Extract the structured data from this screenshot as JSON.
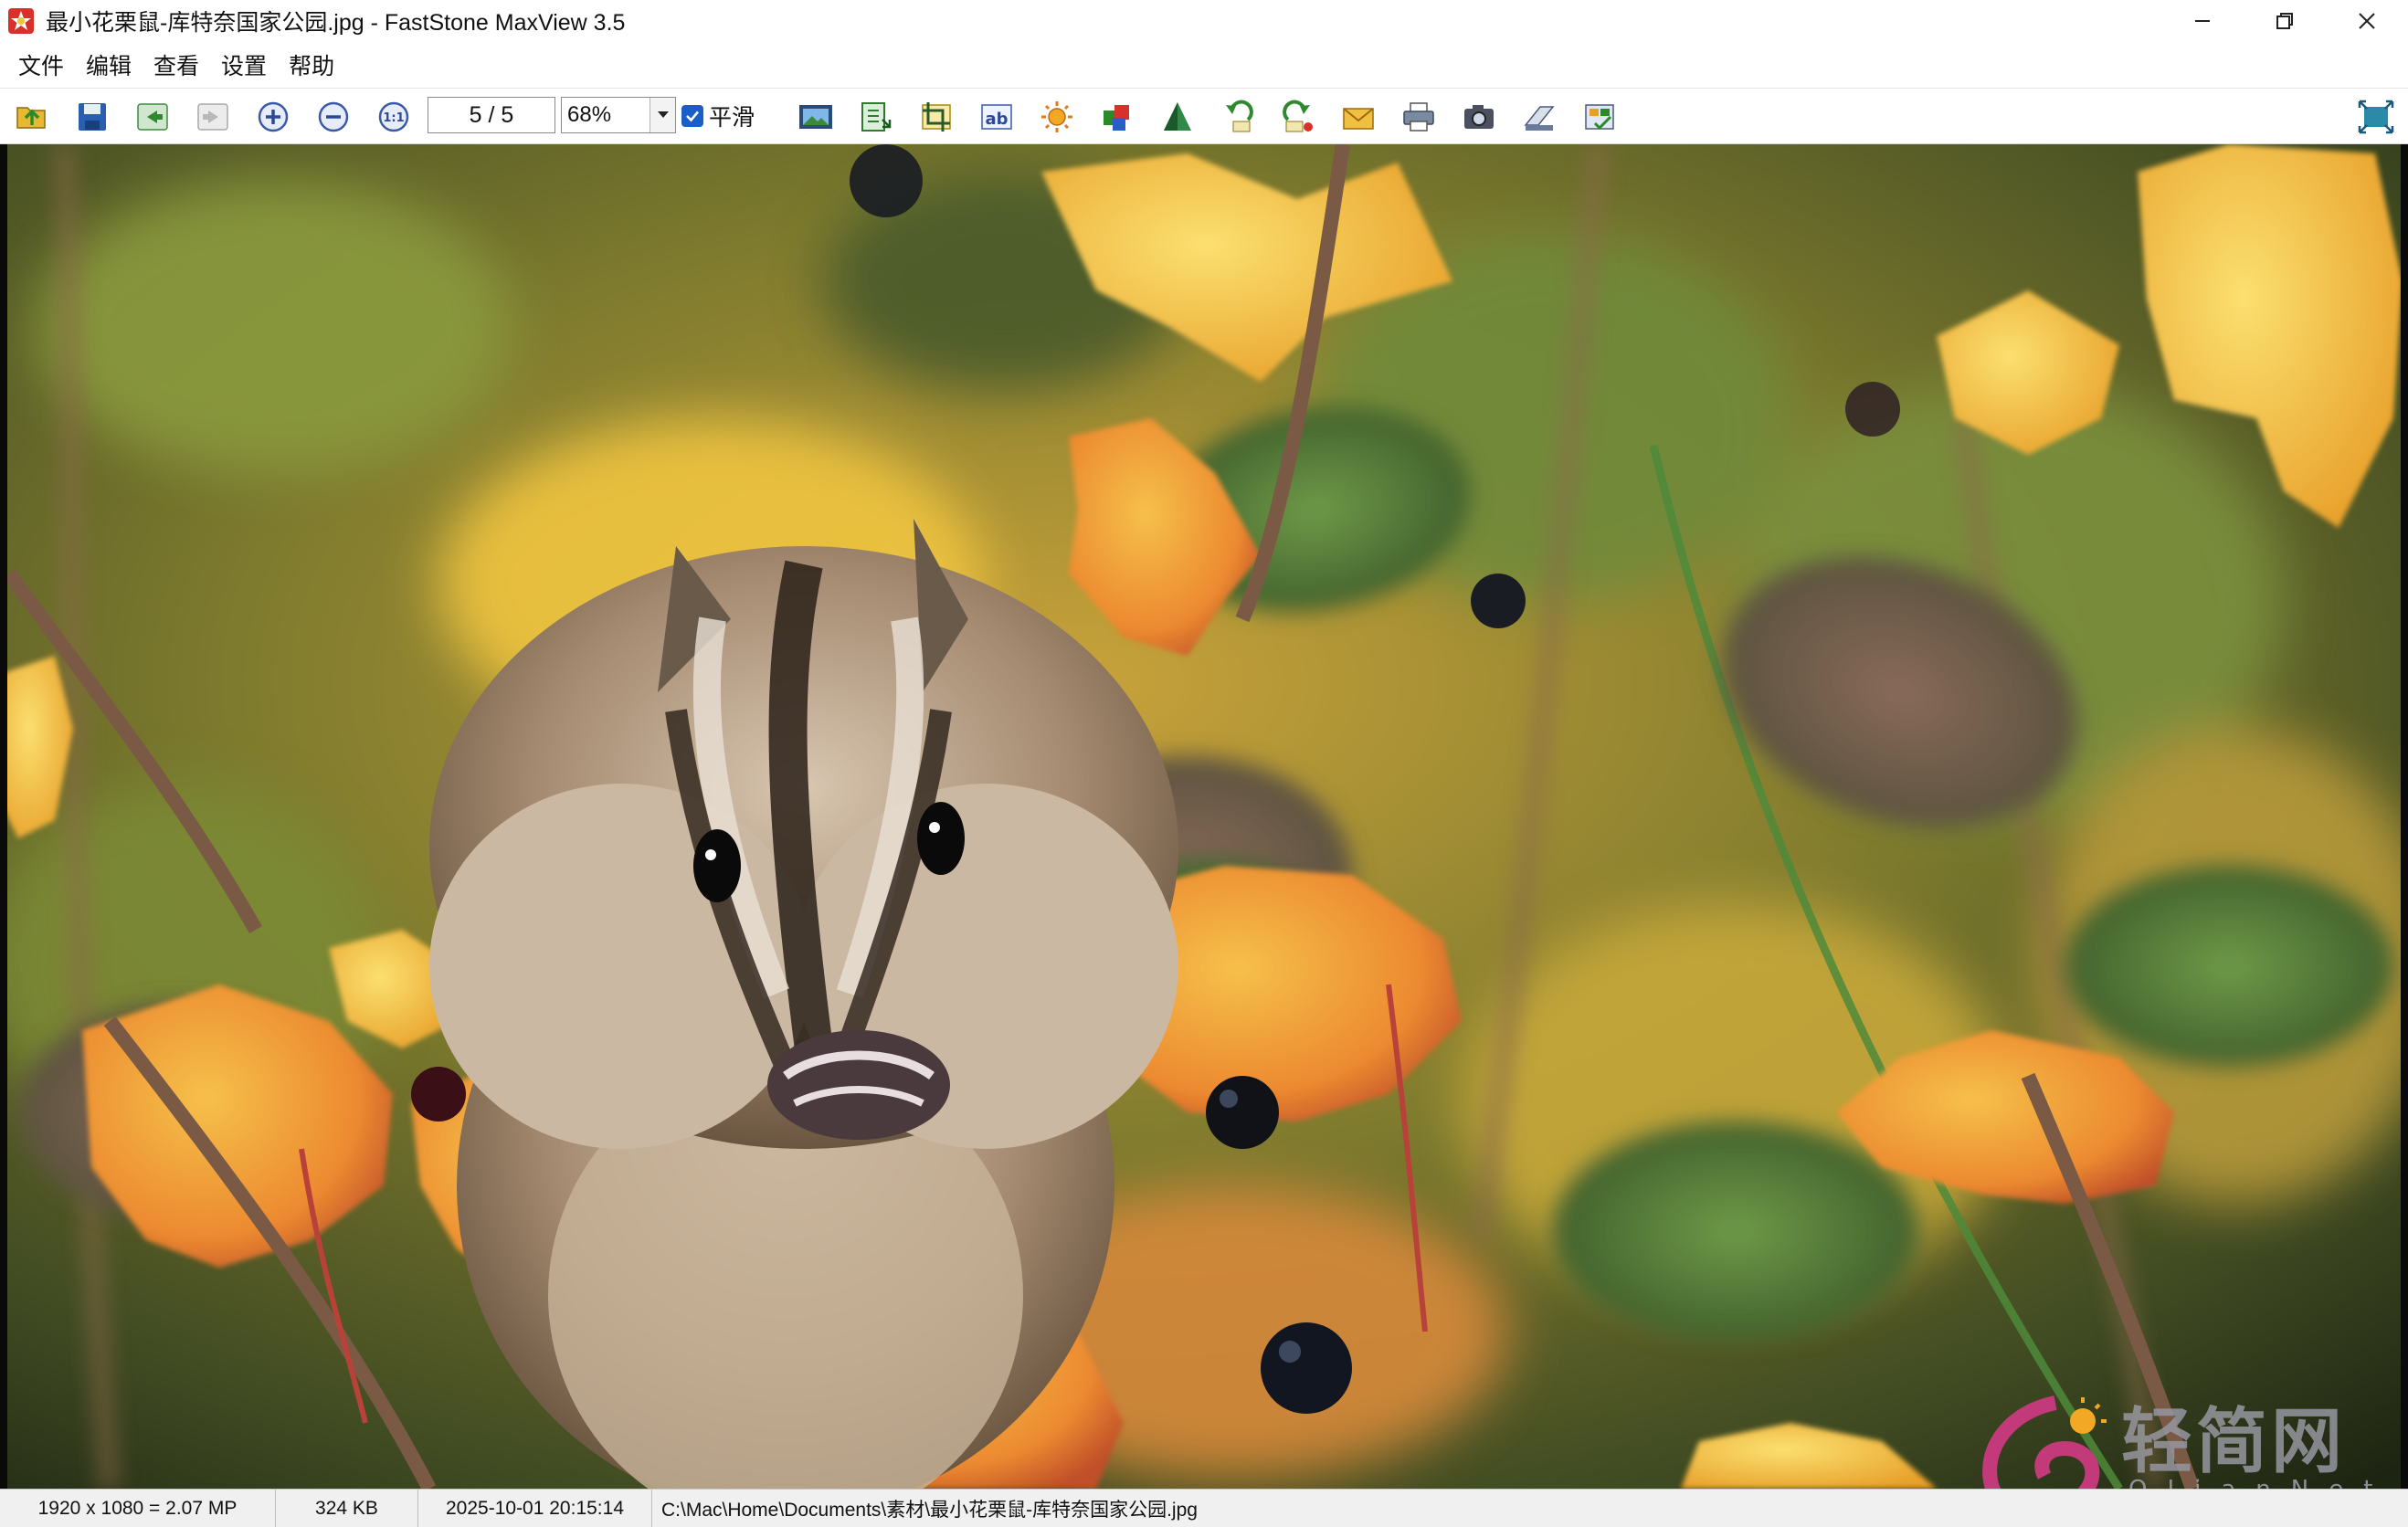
{
  "window": {
    "title": "最小花栗鼠-库特奈国家公园.jpg - FastStone MaxView 3.5",
    "app_icon": "faststone-maxview-icon",
    "controls": [
      "minimize-icon",
      "restore-icon",
      "close-icon"
    ]
  },
  "menu": {
    "items": [
      "文件",
      "编辑",
      "查看",
      "设置",
      "帮助"
    ]
  },
  "toolbar": {
    "page_indicator": "5 / 5",
    "zoom_value": "68%",
    "smooth_label": "平滑",
    "smooth_checked": true,
    "buttons": [
      "open-folder-icon",
      "save-icon",
      "previous-icon",
      "next-icon",
      "zoom-in-icon",
      "zoom-out-icon",
      "actual-size-icon",
      "slideshow-icon",
      "resize-icon",
      "crop-icon",
      "text-icon",
      "brightness-icon",
      "color-icon",
      "sharpen-icon",
      "rotate-left-icon",
      "rotate-right-icon",
      "email-icon",
      "print-icon",
      "camera-icon",
      "scanner-icon",
      "batch-icon",
      "fullscreen-icon"
    ]
  },
  "status": {
    "dimensions": "1920 x 1080 = 2.07 MP",
    "file_size": "324 KB",
    "datetime": "2025-10-01 20:15:14",
    "path": "C:\\Mac\\Home\\Documents\\素材\\最小花栗鼠-库特奈国家公园.jpg"
  },
  "watermark": {
    "text": "轻简网",
    "sub": "QJianNet"
  },
  "colors": {
    "toolbar_bg": "#ffffff",
    "status_bg": "#f0f0f0",
    "checkbox": "#1a5fc8",
    "leaf_orange": "#f09a3c",
    "leaf_yellow": "#f3c43a",
    "foliage_green": "#5f7f3a"
  }
}
